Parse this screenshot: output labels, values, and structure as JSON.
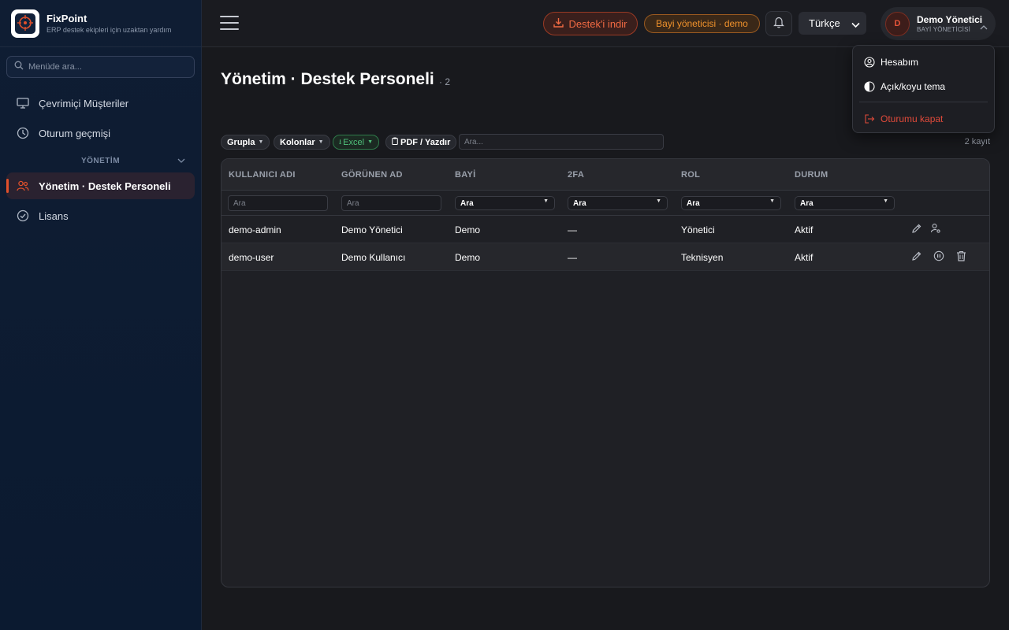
{
  "brand": {
    "name": "FixPoint",
    "subtitle": "ERP destek ekipleri için uzaktan yardım"
  },
  "sidebar": {
    "search_placeholder": "Menüde ara...",
    "items": [
      {
        "label": "Çevrimiçi Müşteriler",
        "icon": "monitor-icon"
      },
      {
        "label": "Oturum geçmişi",
        "icon": "clock-icon"
      }
    ],
    "section": {
      "label": "YÖNETİM"
    },
    "section_items": [
      {
        "label": "Yönetim · Destek Personeli",
        "icon": "users-icon",
        "active": true
      },
      {
        "label": "Lisans",
        "icon": "check-circle-icon"
      }
    ]
  },
  "topbar": {
    "download_label": "Destek'i indir",
    "role_badge": "Bayi yöneticisi · demo",
    "language": "Türkçe",
    "user": {
      "initial": "D",
      "name": "Demo Yönetici",
      "role": "BAYİ YÖNETİCİSİ"
    }
  },
  "page": {
    "title": "Yönetim · Destek Personeli",
    "count": "· 2"
  },
  "toolbar": {
    "group_label": "Grupla",
    "columns_label": "Kolonlar",
    "excel_label": "Excel",
    "pdf_label": "PDF / Yazdır",
    "search_placeholder": "Ara...",
    "record_count": "2 kayıt"
  },
  "table": {
    "columns": [
      "KULLANICI ADI",
      "GÖRÜNEN AD",
      "BAYİ",
      "2FA",
      "ROL",
      "DURUM"
    ],
    "filter_placeholder": "Ara",
    "rows": [
      {
        "username": "demo-admin",
        "display_name": "Demo Yönetici",
        "dealer": "Demo",
        "twofa": "—",
        "role": "Yönetici",
        "status": "Aktif"
      },
      {
        "username": "demo-user",
        "display_name": "Demo Kullanıcı",
        "dealer": "Demo",
        "twofa": "—",
        "role": "Teknisyen",
        "status": "Aktif"
      }
    ]
  },
  "user_menu": {
    "account": "Hesabım",
    "theme": "Açık/koyu tema",
    "logout": "Oturumu kapat"
  },
  "colors": {
    "accent": "#e0502b",
    "danger": "#e04a3a",
    "success": "#4fc07a",
    "warning": "#f0922c"
  }
}
